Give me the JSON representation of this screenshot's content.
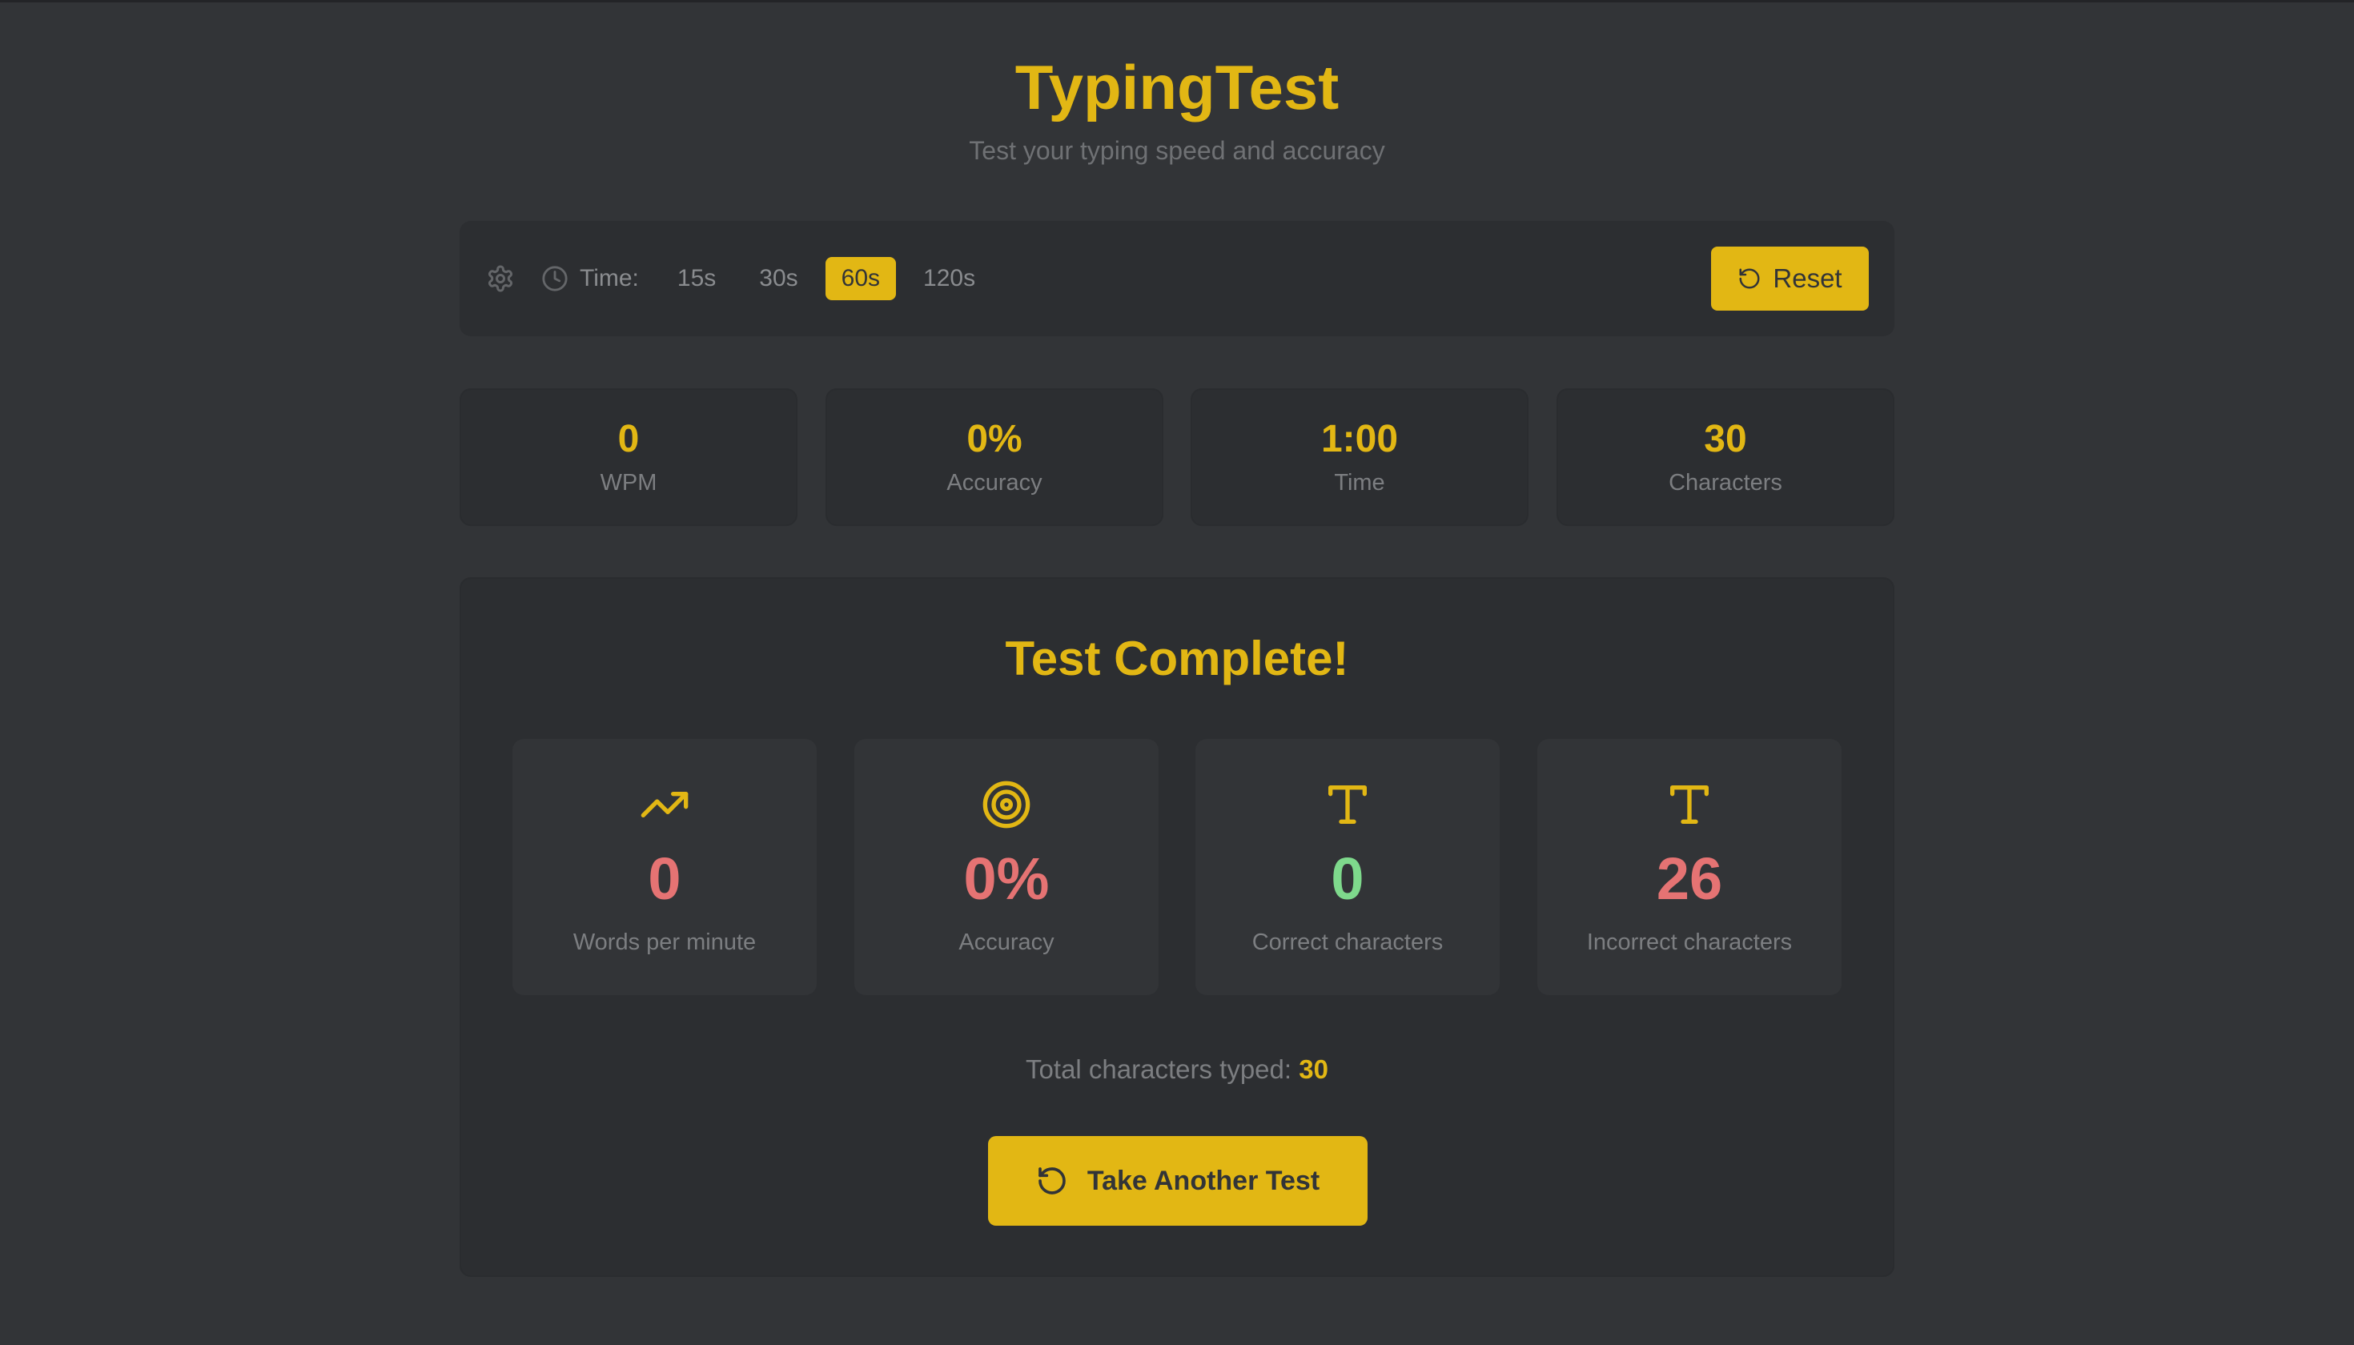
{
  "app": {
    "title": "TypingTest",
    "subtitle": "Test your typing speed and accuracy"
  },
  "toolbar": {
    "settings_icon": "gear-icon",
    "clock_icon": "clock-icon",
    "time_label": "Time:",
    "time_options": [
      "15s",
      "30s",
      "60s",
      "120s"
    ],
    "selected_time": "60s",
    "reset_label": "Reset",
    "reset_icon": "rotate-ccw-icon"
  },
  "stats": [
    {
      "value": "0",
      "label": "WPM"
    },
    {
      "value": "0%",
      "label": "Accuracy"
    },
    {
      "value": "1:00",
      "label": "Time"
    },
    {
      "value": "30",
      "label": "Characters"
    }
  ],
  "results": {
    "title": "Test Complete!",
    "cards": [
      {
        "icon": "trending-up-icon",
        "value": "0",
        "label": "Words per minute",
        "color": "#ca4754"
      },
      {
        "icon": "target-icon",
        "value": "0%",
        "label": "Accuracy",
        "color": "#ca4754"
      },
      {
        "icon": "type-icon",
        "value": "0",
        "label": "Correct characters",
        "color": "#4ade80"
      },
      {
        "icon": "type-icon",
        "value": "26",
        "label": "Incorrect characters",
        "color": "#ca4754"
      }
    ],
    "total_label": "Total characters typed:",
    "total_value": "30",
    "again_label": "Take Another Test",
    "again_icon": "rotate-ccw-icon"
  },
  "colors": {
    "background": "#323437",
    "panel": "#2c2e31",
    "accent": "#e2b714",
    "error": "#ca4754",
    "success": "#4ade80",
    "muted": "#646669"
  }
}
